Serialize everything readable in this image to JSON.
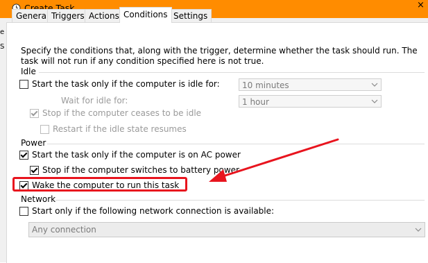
{
  "window": {
    "title": "Create Task",
    "clock_icon": "clock-icon"
  },
  "left_strip": {
    "chars": [
      "e",
      "S"
    ]
  },
  "tabs": [
    {
      "label": "General",
      "active": false
    },
    {
      "label": "Triggers",
      "active": false
    },
    {
      "label": "Actions",
      "active": false
    },
    {
      "label": "Conditions",
      "active": true
    },
    {
      "label": "Settings",
      "active": false
    }
  ],
  "description": "Specify the conditions that, along with the trigger, determine whether the task should run.  The task will not run  if any condition specified here is not true.",
  "idle": {
    "group_label": "Idle",
    "start_if_idle": {
      "label": "Start the task only if the computer is idle for:",
      "checked": false
    },
    "idle_for_value": "10 minutes",
    "wait_label": "Wait for idle for:",
    "wait_value": "1 hour",
    "stop_if_ceases": {
      "label": "Stop if the computer ceases to be idle",
      "checked": true,
      "enabled": false
    },
    "restart_if_resumes": {
      "label": "Restart if the idle state resumes",
      "checked": false,
      "enabled": false
    }
  },
  "power": {
    "group_label": "Power",
    "ac_power": {
      "label": "Start the task only if the computer is on AC power",
      "checked": true
    },
    "battery_stop": {
      "label": "Stop if the computer switches to battery power",
      "checked": true
    },
    "wake": {
      "label": "Wake the computer to run this task",
      "checked": true
    }
  },
  "network": {
    "group_label": "Network",
    "start_only_if": {
      "label": "Start only if the following network connection is available:",
      "checked": false
    },
    "connection_value": "Any connection"
  },
  "annotation": {
    "color": "#e8141e"
  }
}
